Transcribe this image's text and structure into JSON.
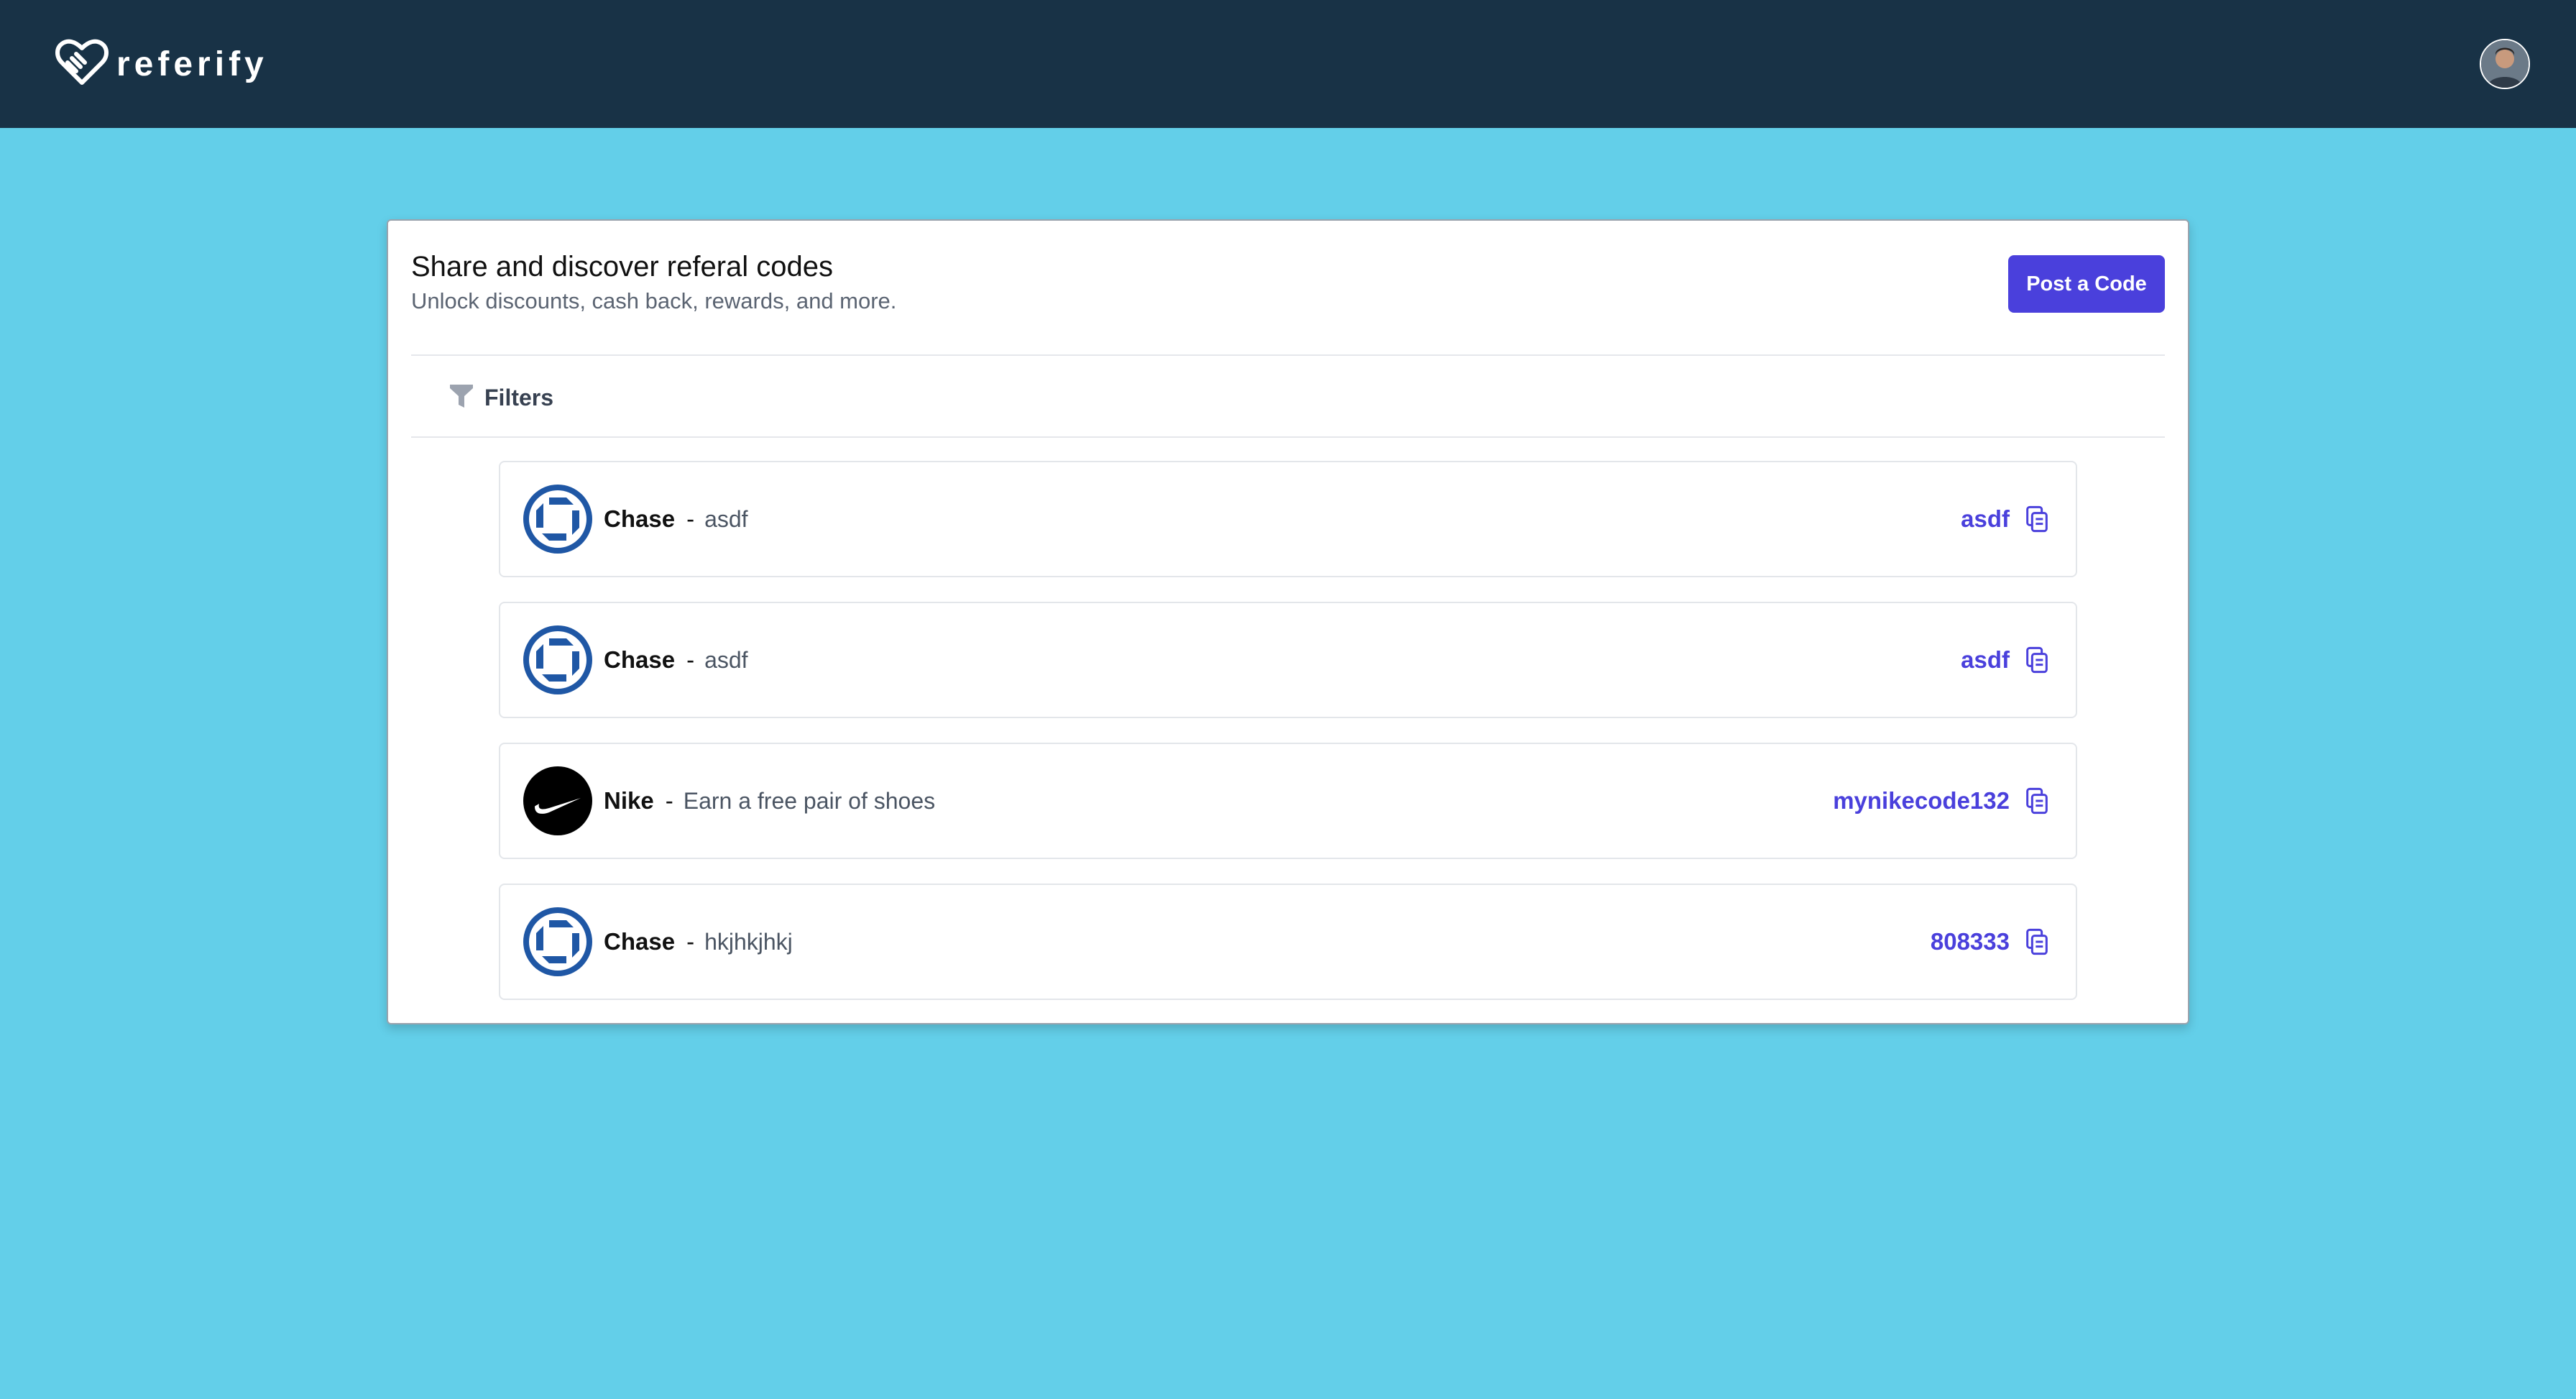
{
  "brand": {
    "name": "referify"
  },
  "colors": {
    "nav": "#183246",
    "background": "#63cfe9",
    "accent": "#4a40dc",
    "chase": "#1f57a5"
  },
  "header": {
    "title": "Share and discover referal codes",
    "subtitle": "Unlock discounts, cash back, rewards, and more.",
    "post_button": "Post a Code"
  },
  "filters": {
    "label": "Filters"
  },
  "referrals": [
    {
      "company": "Chase",
      "separator": "-",
      "description": "asdf",
      "code": "asdf",
      "logo": "chase-logo-icon"
    },
    {
      "company": "Chase",
      "separator": "-",
      "description": "asdf",
      "code": "asdf",
      "logo": "chase-logo-icon"
    },
    {
      "company": "Nike",
      "separator": "-",
      "description": "Earn a free pair of shoes",
      "code": "mynikecode132",
      "logo": "nike-logo-icon"
    },
    {
      "company": "Chase",
      "separator": "-",
      "description": "hkjhkjhkj",
      "code": "808333",
      "logo": "chase-logo-icon"
    }
  ]
}
